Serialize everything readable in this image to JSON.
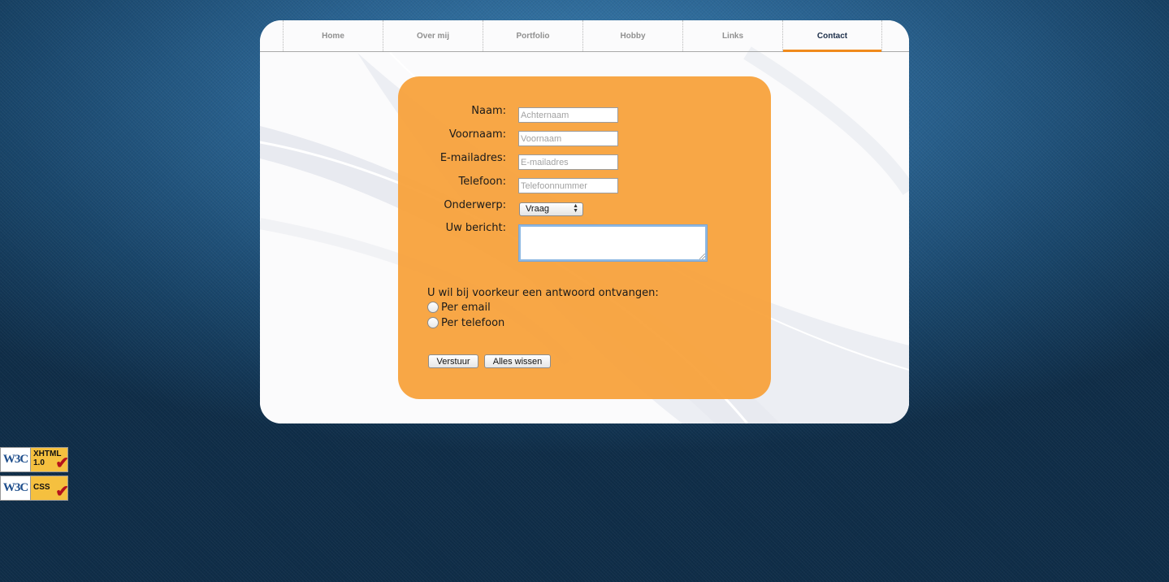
{
  "nav": {
    "items": [
      {
        "label": "Home"
      },
      {
        "label": "Over mij"
      },
      {
        "label": "Portfolio"
      },
      {
        "label": "Hobby"
      },
      {
        "label": "Links"
      },
      {
        "label": "Contact",
        "active": true
      }
    ]
  },
  "form": {
    "name_label": "Naam:",
    "name_placeholder": "Achternaam",
    "firstname_label": "Voornaam:",
    "firstname_placeholder": "Voornaam",
    "email_label": "E-mailadres:",
    "email_placeholder": "E-mailadres",
    "phone_label": "Telefoon:",
    "phone_placeholder": "Telefoonnummer",
    "subject_label": "Onderwerp:",
    "subject_value": "Vraag",
    "message_label": "Uw bericht:",
    "preference_label": "U wil bij voorkeur een antwoord ontvangen:",
    "radio_email": "Per email",
    "radio_phone": "Per telefoon",
    "submit_label": "Verstuur",
    "reset_label": "Alles wissen"
  },
  "badges": {
    "xhtml": {
      "w3c": "W3C",
      "line1": "XHTML",
      "line2": "1.0"
    },
    "css": {
      "w3c": "W3C",
      "line1": "CSS"
    }
  },
  "colors": {
    "accent": "#f08a1c",
    "form_bg": "#f8a038",
    "background": "#2a6391"
  }
}
